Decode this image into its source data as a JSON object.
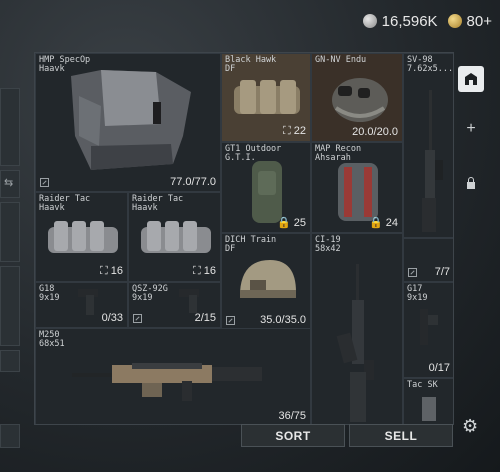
{
  "currency": {
    "silver": "16,596K",
    "gold": "80+"
  },
  "items": {
    "hmp": {
      "name": "HMP SpecOp\nHaavk",
      "count": "77.0/77.0"
    },
    "bh": {
      "name": "Black Hawk\nDF",
      "count": "22"
    },
    "gnnv": {
      "name": "GN-NV Endu",
      "count": "20.0/20.0"
    },
    "sv98": {
      "name": "SV-98\n7.62x5..."
    },
    "gt1": {
      "name": "GT1 Outdoor\nG.T.I.",
      "count": "25"
    },
    "map": {
      "name": "MAP Recon\nAhsarah",
      "count": "24"
    },
    "rt1": {
      "name": "Raider Tac\nHaavk",
      "count": "16"
    },
    "rt2": {
      "name": "Raider Tac\nHaavk",
      "count": "16"
    },
    "sv98b": {
      "count": "7/7"
    },
    "dich": {
      "name": "DICH Train\nDF",
      "count": "35.0/35.0"
    },
    "ci19": {
      "name": "CI-19\n58x42"
    },
    "g18": {
      "name": "G18\n9x19",
      "count": "0/33"
    },
    "qsz": {
      "name": "QSZ-92G\n9x19",
      "count": "2/15"
    },
    "g17": {
      "name": "G17\n9x19",
      "count": "0/17"
    },
    "m250": {
      "name": "M250\n68x51",
      "count": "36/75"
    },
    "tacsk": {
      "name": "Tac SK"
    }
  },
  "buttons": {
    "sort": "SORT",
    "sell": "SELL"
  },
  "rail": {
    "add": "+"
  }
}
